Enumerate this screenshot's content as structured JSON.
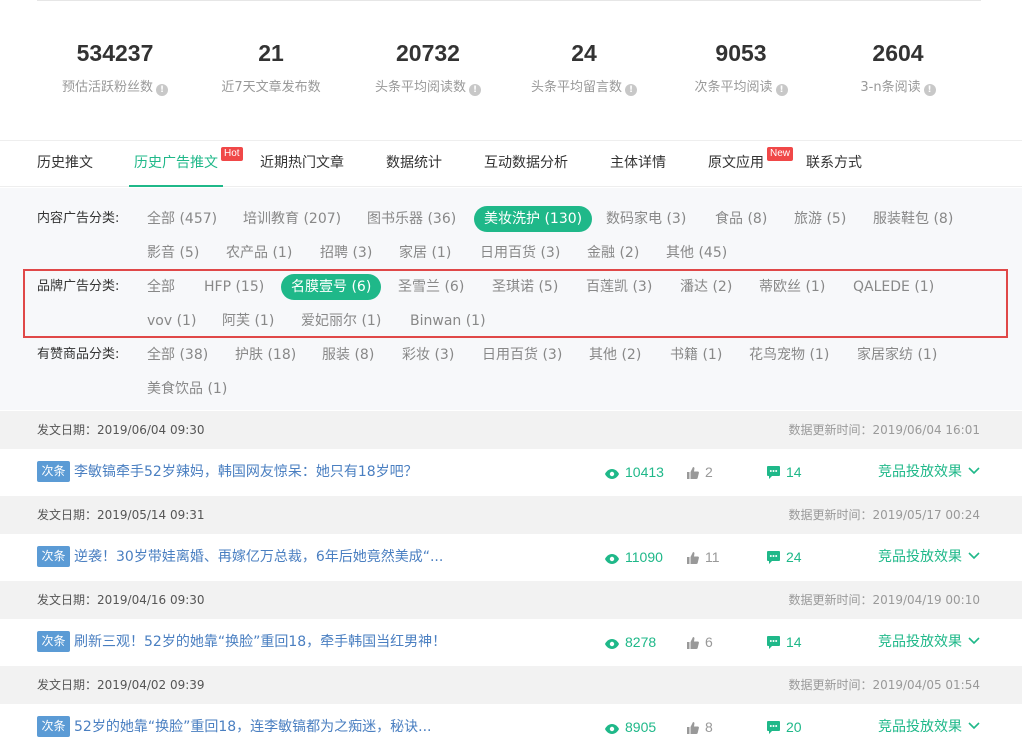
{
  "stats": [
    {
      "value": "534237",
      "label": "预估活跃粉丝数"
    },
    {
      "value": "21",
      "label": "近7天文章发布数"
    },
    {
      "value": "20732",
      "label": "头条平均阅读数"
    },
    {
      "value": "24",
      "label": "头条平均留言数"
    },
    {
      "value": "9053",
      "label": "次条平均阅读"
    },
    {
      "value": "2604",
      "label": "3-n条阅读"
    }
  ],
  "tabs": [
    {
      "label": "历史推文"
    },
    {
      "label": "历史广告推文",
      "badge": "Hot",
      "active": true
    },
    {
      "label": "近期热门文章"
    },
    {
      "label": "数据统计"
    },
    {
      "label": "互动数据分析"
    },
    {
      "label": "主体详情"
    },
    {
      "label": "原文应用",
      "badge": "New"
    },
    {
      "label": "联系方式"
    }
  ],
  "filters": {
    "content": {
      "label": "内容广告分类:",
      "items": [
        "全部 (457)",
        "培训教育 (207)",
        "图书乐器 (36)",
        "美妆洗护 (130)",
        "数码家电 (3)",
        "食品 (8)",
        "旅游 (5)",
        "服装鞋包 (8)",
        "影音 (5)",
        "农产品 (1)",
        "招聘 (3)",
        "家居 (1)",
        "日用百货 (3)",
        "金融 (2)",
        "其他 (45)"
      ],
      "selected": "美妆洗护 (130)"
    },
    "brand": {
      "label": "品牌广告分类:",
      "items": [
        "全部",
        "HFP (15)",
        "名膜壹号 (6)",
        "圣雪兰 (6)",
        "圣琪诺 (5)",
        "百莲凯 (3)",
        "潘达 (2)",
        "蒂欧丝 (1)",
        "QALEDE (1)",
        "vov (1)",
        "阿芙 (1)",
        "爱妃丽尔 (1)",
        "Binwan (1)"
      ],
      "selected": "名膜壹号 (6)"
    },
    "goods": {
      "label": "有赞商品分类:",
      "items": [
        "全部 (38)",
        "护肤 (18)",
        "服装 (8)",
        "彩妆 (3)",
        "日用百货 (3)",
        "其他 (2)",
        "书籍 (1)",
        "花鸟宠物 (1)",
        "家居家纺 (1)",
        "美食饮品 (1)"
      ]
    }
  },
  "articles": [
    {
      "date": "发文日期：2019/06/04 09:30",
      "update": "数据更新时间：2019/06/04 16:01",
      "tag": "次条",
      "title": "李敏镐牵手52岁辣妈，韩国网友惊呆：她只有18岁吧？",
      "views": "10413",
      "likes": "2",
      "comments": "14",
      "effect": "竞品投放效果"
    },
    {
      "date": "发文日期：2019/05/14 09:31",
      "update": "数据更新时间：2019/05/17 00:24",
      "tag": "次条",
      "title": "逆袭！30岁带娃离婚、再嫁亿万总裁，6年后她竟然美成“...",
      "views": "11090",
      "likes": "11",
      "comments": "24",
      "effect": "竞品投放效果"
    },
    {
      "date": "发文日期：2019/04/16 09:30",
      "update": "数据更新时间：2019/04/19 00:10",
      "tag": "次条",
      "title": "刷新三观！52岁的她靠“换脸”重回18，牵手韩国当红男神！",
      "views": "8278",
      "likes": "6",
      "comments": "14",
      "effect": "竞品投放效果"
    },
    {
      "date": "发文日期：2019/04/02 09:39",
      "update": "数据更新时间：2019/04/05 01:54",
      "tag": "次条",
      "title": "52岁的她靠“换脸”重回18，连李敏镐都为之痴迷，秘诀...",
      "views": "8905",
      "likes": "8",
      "comments": "20",
      "effect": "竞品投放效果"
    }
  ],
  "icons": {
    "info": "info-icon",
    "eye": "eye-icon",
    "thumb": "thumbs-up-icon",
    "comment": "comment-icon",
    "chevron": "chevron-down-icon"
  },
  "colors": {
    "accent": "#1fb889",
    "badge": "#f04848",
    "tag": "#5b9bd5",
    "link": "#4a7fc1",
    "highlight": "#e04848"
  }
}
